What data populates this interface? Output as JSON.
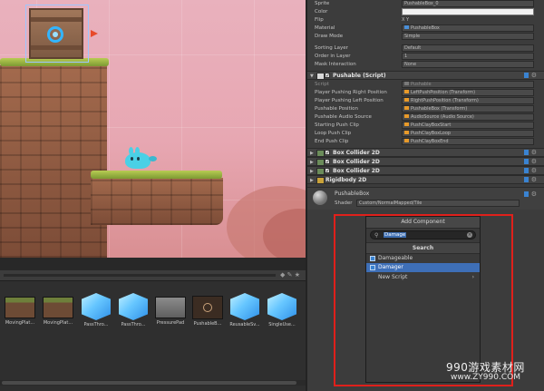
{
  "inspector": {
    "sprite_renderer": [
      {
        "key": "Sprite",
        "value": "PushableBox_0"
      },
      {
        "key": "Color",
        "value": ""
      },
      {
        "key": "Flip",
        "value": "X  Y"
      },
      {
        "key": "Material",
        "value": "PushableBox"
      },
      {
        "key": "Draw Mode",
        "value": "Simple"
      }
    ],
    "sorting": [
      {
        "key": "Sorting Layer",
        "value": "Default"
      },
      {
        "key": "Order in Layer",
        "value": "1"
      },
      {
        "key": "Mask Interaction",
        "value": "None"
      }
    ],
    "pushable": {
      "title": "Pushable (Script)",
      "fields": [
        {
          "key": "Script",
          "value": "Pushable"
        },
        {
          "key": "Player Pushing Right Position",
          "value": "LeftPushPosition (Transform)"
        },
        {
          "key": "Player Pushing Left Position",
          "value": "RightPushPosition (Transform)"
        },
        {
          "key": "Pushable Position",
          "value": "PushableBox (Transform)"
        },
        {
          "key": "Pushable Audio Source",
          "value": "AudioSource (Audio Source)"
        },
        {
          "key": "Starting Push Clip",
          "value": "PushClayBoxStart"
        },
        {
          "key": "Loop Push Clip",
          "value": "PushClayBoxLoop"
        },
        {
          "key": "End Push Clip",
          "value": "PushClayBoxEnd"
        }
      ]
    },
    "components": [
      "Box Collider 2D",
      "Box Collider 2D",
      "Box Collider 2D",
      "Rigidbody 2D"
    ],
    "material": {
      "name": "PushableBox",
      "shader_label": "Shader",
      "shader_value": "Custom/NormalMapped/Tile"
    }
  },
  "add_component": {
    "title": "Add Component",
    "search_value": "Damage",
    "search_header": "Search",
    "results": [
      {
        "label": "Damageable",
        "selected": false
      },
      {
        "label": "Damager",
        "selected": true
      }
    ],
    "new_script": "New Script"
  },
  "project": {
    "assets": [
      "MovingPlat...",
      "MovingPlat...",
      "PassThro...",
      "PassThro...",
      "PressurePad",
      "PushableB...",
      "ReusableSv...",
      "SingleUse..."
    ]
  },
  "watermark": {
    "line1": "990游戏素材网",
    "line2": "www.ZY990.COM"
  },
  "colors": {
    "selection": "#3e6fb7",
    "highlight_border": "#e0201b",
    "script_icon": "#3a83d1"
  }
}
